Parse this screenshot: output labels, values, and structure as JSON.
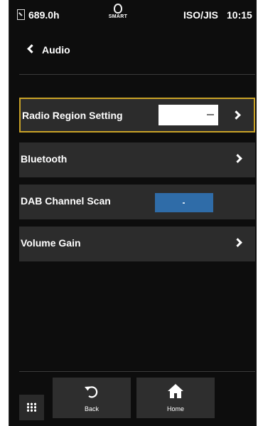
{
  "status_bar": {
    "hours": "689.0h",
    "smart_label": "SMART",
    "standard": "ISO/JIS",
    "time": "10:15"
  },
  "header": {
    "title": "Audio"
  },
  "menu": {
    "items": [
      {
        "label": "Radio Region Setting",
        "value": "—"
      },
      {
        "label": "Bluetooth"
      },
      {
        "label": "DAB Channel Scan",
        "button_text": "-"
      },
      {
        "label": "Volume Gain"
      }
    ]
  },
  "bottom_nav": {
    "back_label": "Back",
    "home_label": "Home"
  },
  "colors": {
    "background": "#0d0d0d",
    "row": "#2c2c2c",
    "selected_border": "#c9a227",
    "scan_button": "#2f6ca8"
  }
}
